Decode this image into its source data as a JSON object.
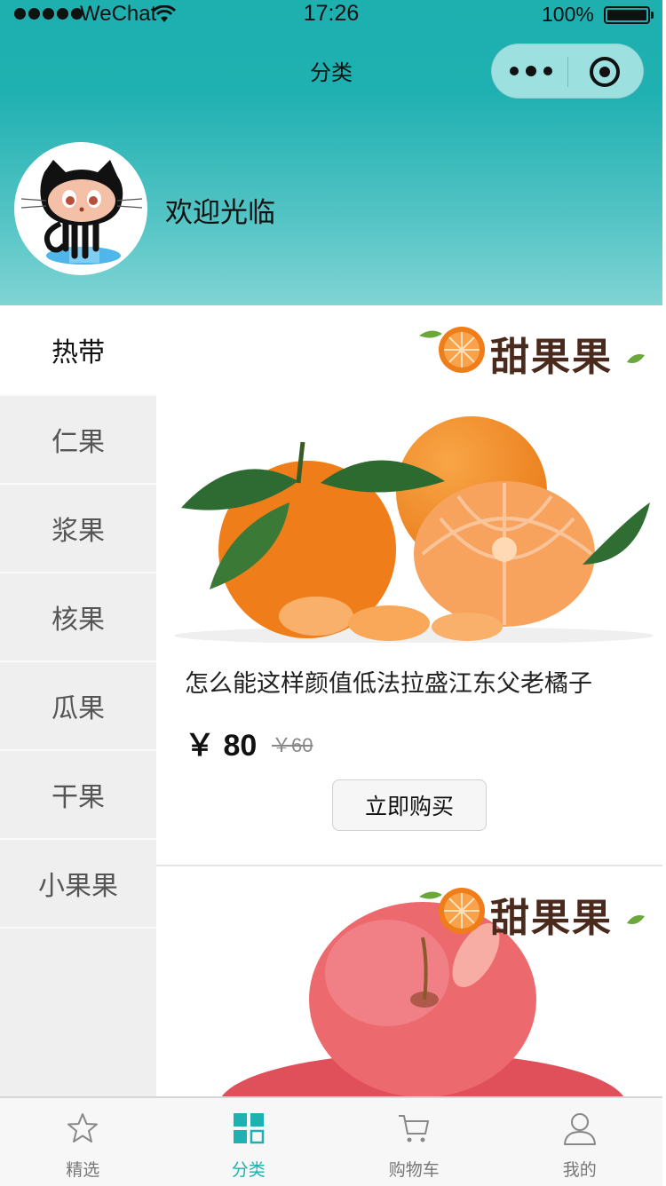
{
  "status_bar": {
    "carrier": "WeChat",
    "time": "17:26",
    "battery": "100%"
  },
  "nav": {
    "title": "分类",
    "more_icon": "more-dots-icon",
    "close_icon": "close-circle-icon"
  },
  "header": {
    "welcome": "欢迎光临",
    "avatar_icon": "octocat-avatar"
  },
  "colors": {
    "accent": "#1fb0b1",
    "sidebar_bg": "#efefef",
    "tab_inactive": "#777777"
  },
  "sidebar": {
    "active_index": 0,
    "items": [
      {
        "label": "热带"
      },
      {
        "label": "仁果"
      },
      {
        "label": "浆果"
      },
      {
        "label": "核果"
      },
      {
        "label": "瓜果"
      },
      {
        "label": "干果"
      },
      {
        "label": "小果果"
      }
    ]
  },
  "products": [
    {
      "brand": "甜果果",
      "image": "tangerine-image",
      "title": "怎么能这样颜值低法拉盛江东父老橘子",
      "price": "￥ 80",
      "old_price": "￥60",
      "buy_label": "立即购买"
    },
    {
      "brand": "甜果果",
      "image": "apple-image"
    }
  ],
  "tabbar": {
    "active_index": 1,
    "items": [
      {
        "label": "精选",
        "icon": "star-icon"
      },
      {
        "label": "分类",
        "icon": "category-grid-icon"
      },
      {
        "label": "购物车",
        "icon": "cart-icon"
      },
      {
        "label": "我的",
        "icon": "user-icon"
      }
    ]
  }
}
